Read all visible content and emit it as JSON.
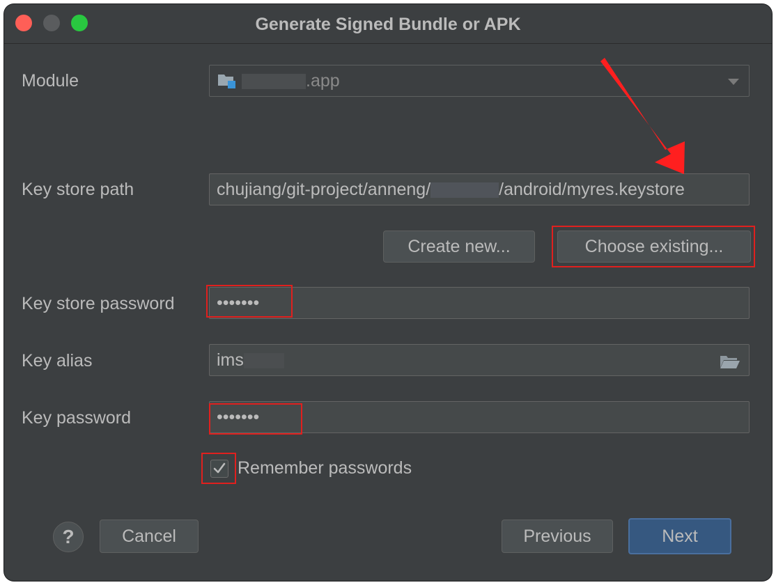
{
  "window": {
    "title": "Generate Signed Bundle or APK"
  },
  "module": {
    "label": "Module",
    "value_suffix": ".app"
  },
  "keystore": {
    "label": "Key store path",
    "path_prefix": "chujiang/git-project/anneng/",
    "path_suffix": "/android/myres.keystore",
    "create_new_label": "Create new...",
    "choose_existing_label": "Choose existing..."
  },
  "keystore_password": {
    "label": "Key store password",
    "value": "•••••••"
  },
  "key_alias": {
    "label": "Key alias",
    "value": "ims"
  },
  "key_password": {
    "label": "Key password",
    "value": "•••••••"
  },
  "remember": {
    "label": "Remember passwords",
    "checked": true
  },
  "footer": {
    "help_label": "?",
    "cancel_label": "Cancel",
    "previous_label": "Previous",
    "next_label": "Next"
  },
  "annotation_color": "#e0201e"
}
